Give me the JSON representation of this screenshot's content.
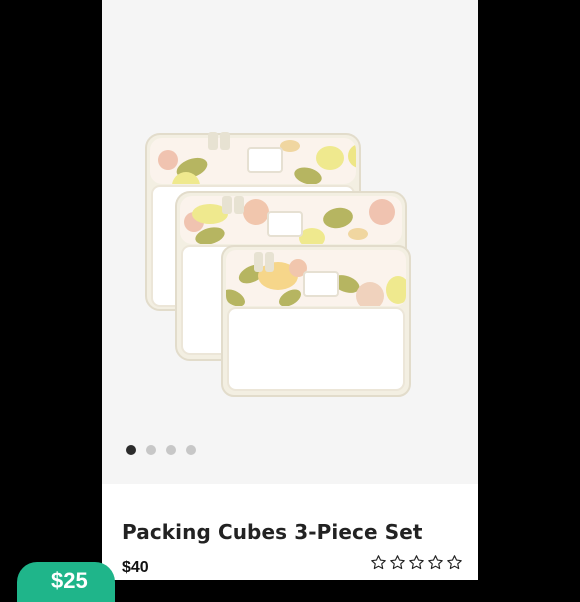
{
  "product": {
    "title": "Packing Cubes 3-Piece Set",
    "price": "$40",
    "rating_stars_total": 5,
    "rating_stars_filled": 0
  },
  "gallery": {
    "image_count": 4,
    "active_index": 0
  },
  "badge": {
    "text": "$25",
    "color": "#1fb58a"
  },
  "colors": {
    "page_bg": "#000000",
    "card_bg": "#ffffff",
    "gallery_bg": "#f5f5f5",
    "active_dot": "#2b2b2b",
    "inactive_dot": "#c7c7c7"
  }
}
